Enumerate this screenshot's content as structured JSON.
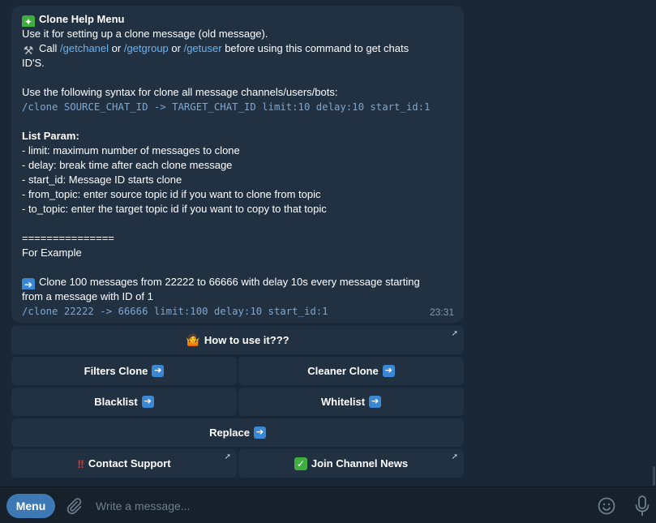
{
  "message": {
    "title": "Clone Help Menu",
    "intro": "Use it for setting up a clone message (old message).",
    "call_prefix": "Call",
    "cmd_getchanel": "/getchanel",
    "or1": "or",
    "cmd_getgroup": "/getgroup",
    "or2": "or",
    "cmd_getuser": "/getuser",
    "call_suffix": "before using this command to get chats",
    "call_suffix2": "ID'S.",
    "syntax_intro": "Use the following syntax for clone all message channels/users/bots:",
    "syntax_cmd": "/clone SOURCE_CHAT_ID -> TARGET_CHAT_ID limit:10 delay:10 start_id:1",
    "param_title": "List Param:",
    "params": [
      "- limit: maximum number of messages to clone",
      "- delay: break time after each clone message",
      "- start_id: Message ID starts clone",
      "- from_topic: enter source topic id if you want to clone from topic",
      "- to_topic: enter the target topic id if you want to copy to that topic"
    ],
    "separator": "===============",
    "example_title": "For Example",
    "example_desc": "Clone 100 messages from 22222 to 66666 with delay 10s every message starting",
    "example_desc2": "from a message with ID of 1",
    "example_cmd": "/clone 22222 -> 66666 limit:100 delay:10 start_id:1",
    "time": "23:31"
  },
  "keyboard": {
    "how_to": "How to use it???",
    "filters_clone": "Filters Clone",
    "cleaner_clone": "Cleaner Clone",
    "blacklist": "Blacklist",
    "whitelist": "Whitelist",
    "replace": "Replace",
    "contact_support": "Contact Support",
    "join_channel": "Join Channel News"
  },
  "composer": {
    "menu_label": "Menu",
    "placeholder": "Write a message..."
  },
  "colors": {
    "background": "#1a2736",
    "bubble": "#213142",
    "link": "#6ab3f3",
    "menu_button": "#3e79b5"
  },
  "icons": [
    "sparkle-icon",
    "tools-icon",
    "arrow-right-icon",
    "person-shrug-icon",
    "double-exclamation-icon",
    "check-mark-icon",
    "external-link-icon",
    "attach-icon",
    "emoji-icon",
    "microphone-icon"
  ]
}
